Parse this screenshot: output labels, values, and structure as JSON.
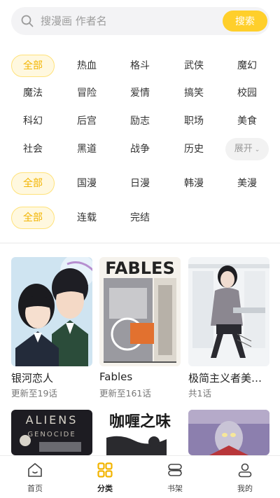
{
  "search": {
    "placeholder": "搜漫画 作者名",
    "button_label": "搜索"
  },
  "filters": {
    "genre": {
      "all_label": "全部",
      "items": [
        "热血",
        "格斗",
        "武侠",
        "魔幻",
        "魔法",
        "冒险",
        "爱情",
        "搞笑",
        "校园",
        "科幻",
        "后宫",
        "励志",
        "职场",
        "美食",
        "社会",
        "黑道",
        "战争",
        "历史"
      ],
      "more_label": "展开"
    },
    "region": {
      "all_label": "全部",
      "items": [
        "国漫",
        "日漫",
        "韩漫",
        "美漫"
      ]
    },
    "status": {
      "all_label": "全部",
      "items": [
        "连载",
        "完结"
      ]
    }
  },
  "comics": [
    {
      "title": "银河恋人",
      "subtitle": "更新至19话"
    },
    {
      "title": "Fables",
      "subtitle": "更新至161话"
    },
    {
      "title": "极简主义者美少女的小…",
      "subtitle": "共1话"
    }
  ],
  "cover_text": {
    "fables": "FABLES",
    "aliens_top": "ALIENS",
    "aliens_bottom": "GENOCIDE",
    "curry": "咖喱之味"
  },
  "bottom_nav": {
    "items": [
      {
        "label": "首页",
        "icon": "home-icon"
      },
      {
        "label": "分类",
        "icon": "category-grid-icon"
      },
      {
        "label": "书架",
        "icon": "bookshelf-icon"
      },
      {
        "label": "我的",
        "icon": "user-icon"
      }
    ],
    "active_index": 1
  },
  "colors": {
    "accent": "#ffcf2b",
    "accent_text": "#f2b400",
    "chip_active_bg": "#fff8df"
  }
}
